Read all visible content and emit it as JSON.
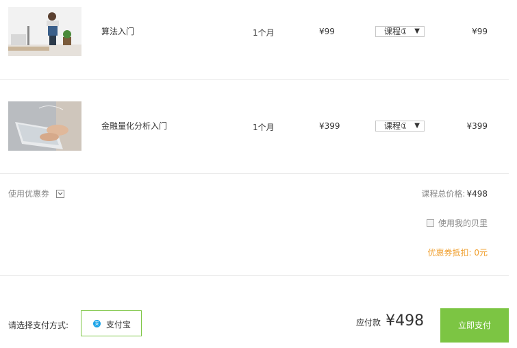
{
  "items": [
    {
      "name": "算法入门",
      "duration": "1个月",
      "price": "¥99",
      "type": "课程①",
      "subtotal": "¥99"
    },
    {
      "name": "金融量化分析入门",
      "duration": "1个月",
      "price": "¥399",
      "type": "课程①",
      "subtotal": "¥399"
    }
  ],
  "coupon": {
    "label": "使用优惠券"
  },
  "summary": {
    "total_label": "课程总价格:",
    "total_value": "¥498",
    "use_beili_label": "使用我的贝里",
    "discount_text": "优惠券抵扣: 0元"
  },
  "payment": {
    "prompt": "请选择支付方式:",
    "method": "支付宝",
    "due_label": "应付款",
    "due_amount": "¥498",
    "pay_button": "立即支付"
  },
  "colors": {
    "accent_green": "#7cc543",
    "alipay_blue": "#1aa3e8",
    "discount_orange": "#f0a030"
  }
}
